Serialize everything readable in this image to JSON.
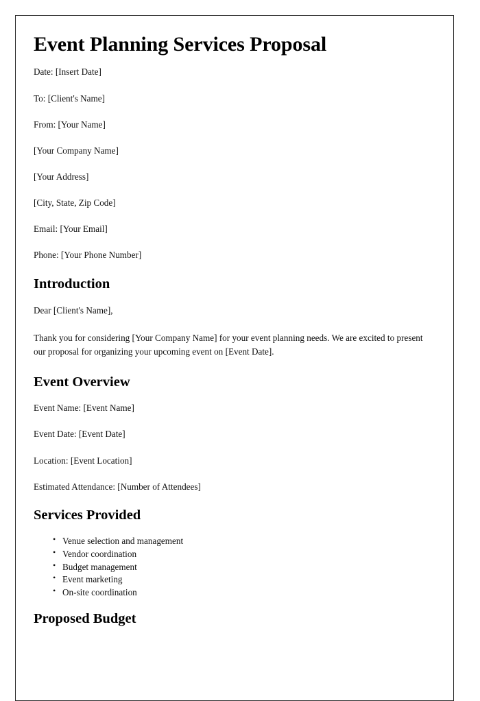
{
  "document": {
    "title": "Event Planning Services Proposal",
    "header_block": [
      "Date: [Insert Date]",
      "To: [Client's Name]",
      "From: [Your Name]",
      "[Your Company Name]",
      "[Your Address]",
      "[City, State, Zip Code]",
      "Email: [Your Email]",
      "Phone: [Your Phone Number]"
    ],
    "sections": {
      "introduction": {
        "heading": "Introduction",
        "salutation": "Dear [Client's Name],",
        "paragraph": "Thank you for considering [Your Company Name] for your event planning needs. We are excited to present our proposal for organizing your upcoming event on [Event Date]."
      },
      "event_overview": {
        "heading": "Event Overview",
        "facts": [
          "Event Name: [Event Name]",
          "Event Date: [Event Date]",
          "Location: [Event Location]",
          "Estimated Attendance: [Number of Attendees]"
        ]
      },
      "services_provided": {
        "heading": "Services Provided",
        "items": [
          "Venue selection and management",
          "Vendor coordination",
          "Budget management",
          "Event marketing",
          "On-site coordination"
        ]
      },
      "proposed_budget": {
        "heading": "Proposed Budget"
      }
    }
  }
}
